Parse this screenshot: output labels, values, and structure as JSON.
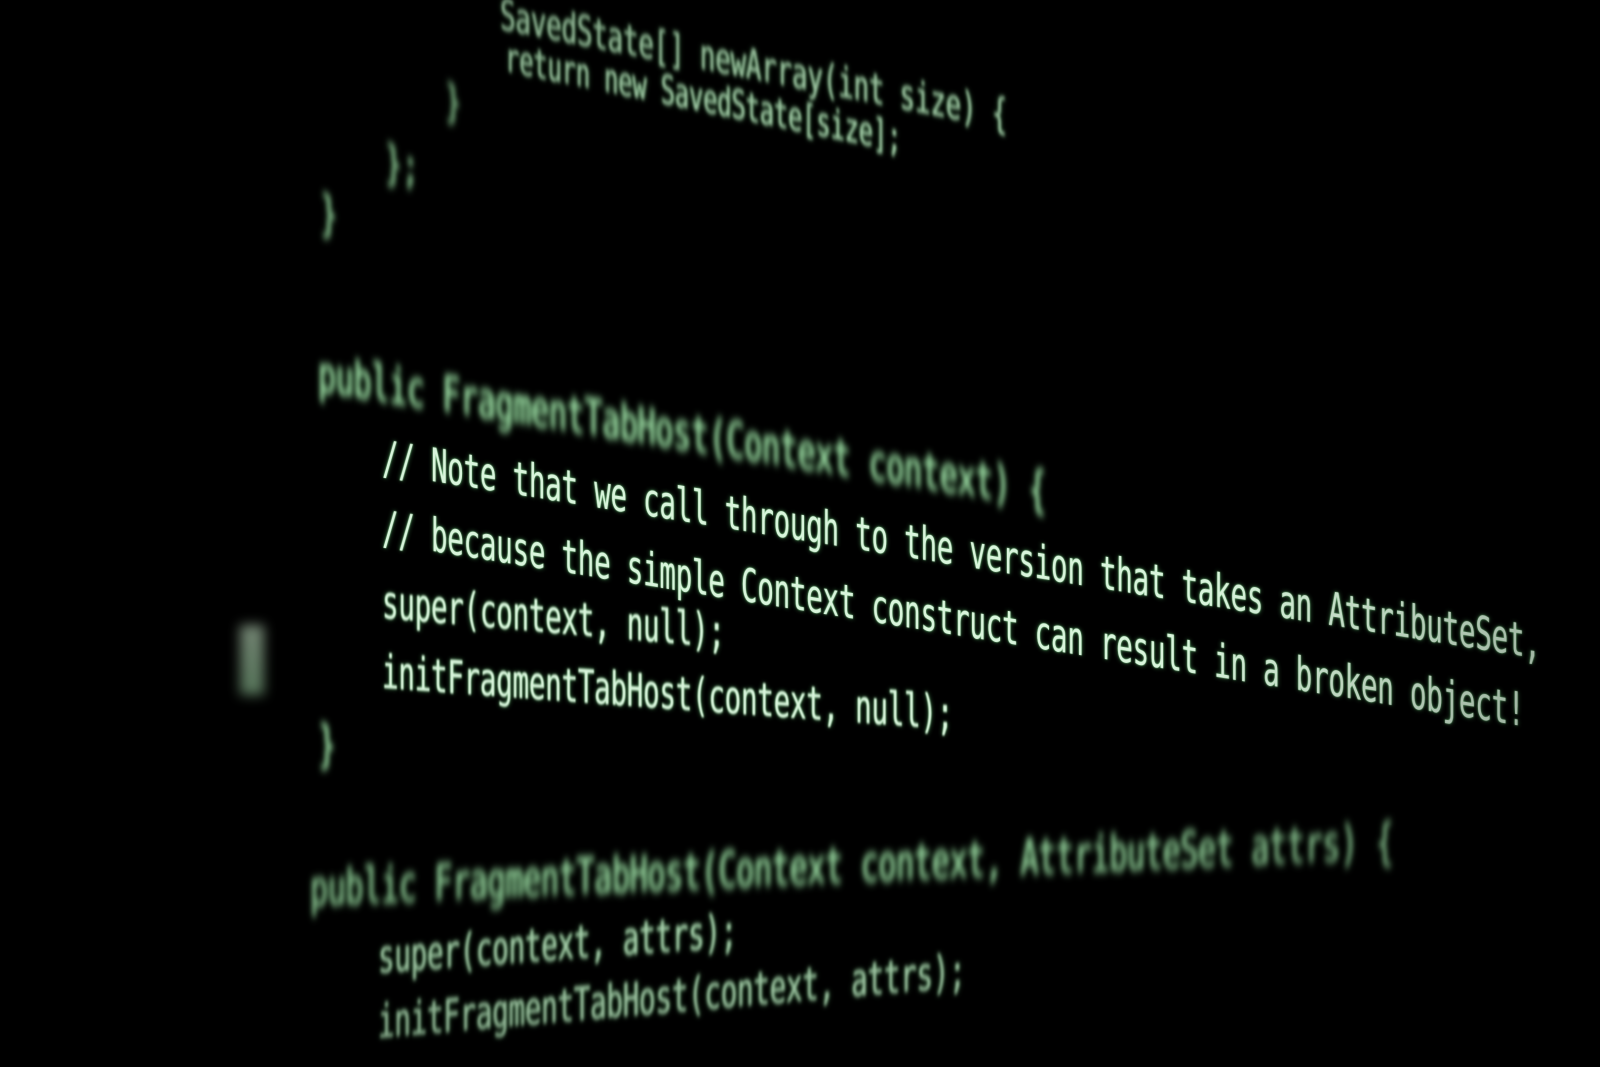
{
  "scene": {
    "background_color": "#000000",
    "text_color": "#d9f5dc",
    "glow_color": "#8fe39a"
  },
  "code_lines": [
    "SavedState[] newArray(int size) {",
    "return new SavedState[size];",
    "}",
    "};",
    "}",
    "public FragmentTabHost(Context context) {",
    "// Note that we call through to the version that takes an AttributeSet,",
    "// because the simple Context construct can result in a broken object!",
    "super(context, null);",
    "initFragmentTabHost(context, null);",
    "}",
    "public FragmentTabHost(Context context, AttributeSet attrs) {",
    "super(context, attrs);",
    "initFragmentTabHost(context, attrs);"
  ]
}
